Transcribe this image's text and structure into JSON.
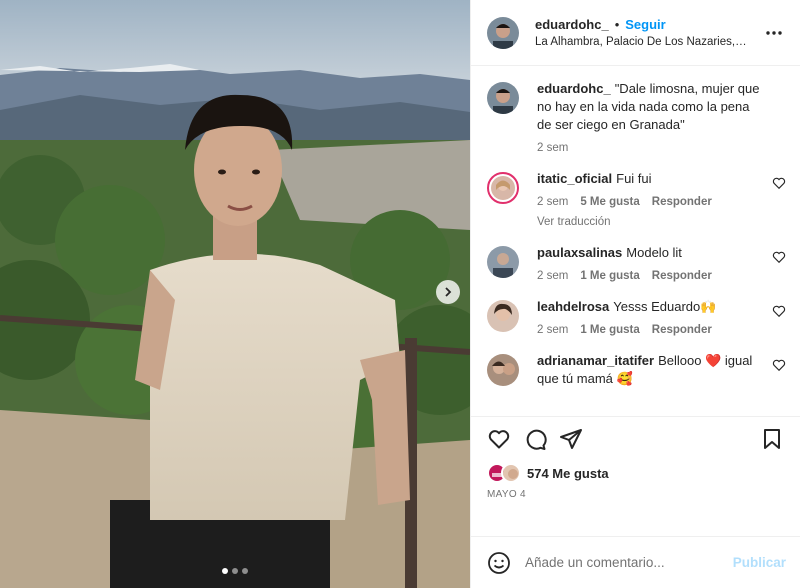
{
  "post": {
    "author": "eduardohc_",
    "separator": "•",
    "follow_label": "Seguir",
    "location": "La Alhambra, Palacio De Los Nazaries, ...",
    "more_icon": "more-horizontal-icon",
    "carousel": {
      "total_slides": 3,
      "active_slide": 1
    }
  },
  "caption": {
    "username": "eduardohc_",
    "text": "\"Dale limosna, mujer que no hay en la vida nada como la pena de ser ciego en Granada\"",
    "time": "2 sem"
  },
  "comments": [
    {
      "username": "itatic_oficial",
      "text": "Fui fui",
      "time": "2 sem",
      "likes": "5 Me gusta",
      "reply": "Responder",
      "translate": "Ver traducción"
    },
    {
      "username": "paulaxsalinas",
      "text": "Modelo lit",
      "time": "2 sem",
      "likes": "1 Me gusta",
      "reply": "Responder"
    },
    {
      "username": "leahdelrosa",
      "text": "Yesss Eduardo🙌",
      "time": "2 sem",
      "likes": "1 Me gusta",
      "reply": "Responder"
    },
    {
      "username": "adrianamar_itatifer",
      "text": "Bellooo ❤️ igual que tú mamá 🥰"
    }
  ],
  "actions": {
    "likes": "574 Me gusta",
    "date": "MAYO 4"
  },
  "add_comment": {
    "placeholder": "Añade un comentario...",
    "publish_label": "Publicar"
  },
  "colors": {
    "accent": "#0095f6",
    "publish_disabled": "#b2dffc",
    "muted": "#737373"
  }
}
